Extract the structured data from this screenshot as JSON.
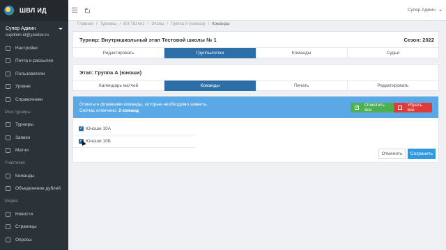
{
  "app": {
    "title": "ШВЛ ИД"
  },
  "user": {
    "name": "Супер Админ",
    "email": "supdmin-id@yandex.ru"
  },
  "sidebar": {
    "items": [
      {
        "label": "Настройки",
        "icon": "settings-icon"
      },
      {
        "label": "Почта и рассылки",
        "icon": "mail-icon"
      },
      {
        "label": "Пользователи",
        "icon": "users-icon"
      },
      {
        "label": "Уровни",
        "icon": "levels-icon"
      },
      {
        "label": "Справочники",
        "icon": "book-icon"
      }
    ],
    "section_tournaments": "Мои турниры",
    "tournament_items": [
      {
        "label": "Турниры",
        "icon": "trophy-icon"
      },
      {
        "label": "Заявки",
        "icon": "document-icon"
      },
      {
        "label": "Матчи",
        "icon": "match-icon"
      }
    ],
    "section_participants": "Участники",
    "participant_items": [
      {
        "label": "Команды",
        "icon": "team-icon"
      },
      {
        "label": "Объединение дублей",
        "icon": "merge-icon"
      }
    ],
    "section_media": "Медиа",
    "media_items": [
      {
        "label": "Новости",
        "icon": "news-icon"
      },
      {
        "label": "Страницы",
        "icon": "page-icon"
      },
      {
        "label": "Опросы",
        "icon": "poll-icon"
      }
    ]
  },
  "topbar": {
    "user": "Супер Админ"
  },
  "breadcrumb": [
    "Главная",
    "Турниры",
    "ВЭ ТШ №1",
    "Этапы",
    "Группа А (юноши)",
    "Команды"
  ],
  "tournament": {
    "title": "Турнир: Внутришкольный этап Тестовой школы № 1",
    "season": "Сезон: 2022",
    "tabs": [
      "Редактировать",
      "Группы/сетки",
      "Команды",
      "Судьи"
    ]
  },
  "stage": {
    "title": "Этап: Группа А (юноши)",
    "tabs": [
      "Календарь матчей",
      "Команды",
      "Печать",
      "Редактировать"
    ]
  },
  "alert": {
    "line1": "Отметьте флажками команды, которые необходимо заявить.",
    "line2_prefix": "Сейчас отмечено:",
    "line2_count": "2 команд",
    "select_all": "Отметить все",
    "deselect_all": "Убрать все"
  },
  "teams": [
    {
      "name": "Юноши 10А",
      "checked": true
    },
    {
      "name": "Юноши 10Б",
      "checked": true
    }
  ],
  "actions": {
    "cancel": "Отменить",
    "save": "Сохранить"
  },
  "colors": {
    "sidebar": "#2c3338",
    "active_tab": "#2c6fa8",
    "alert": "#5aa9e6",
    "green": "#4caf50",
    "red": "#e03a3a",
    "save": "#2f9ae0"
  }
}
